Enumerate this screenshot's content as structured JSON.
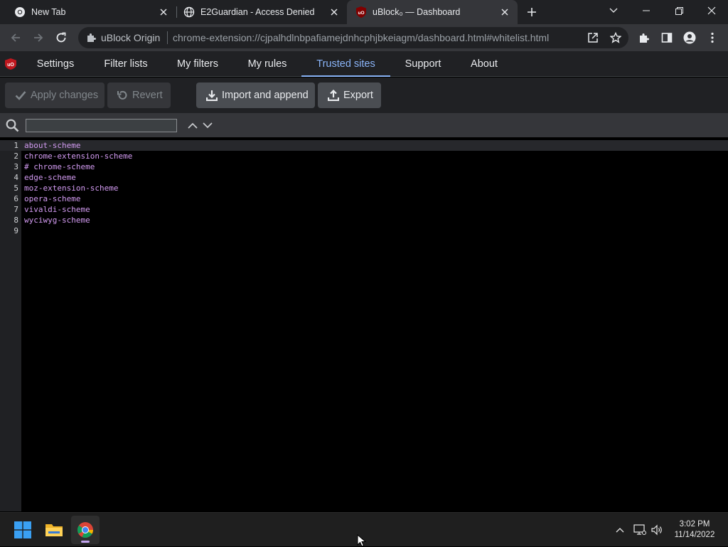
{
  "browser": {
    "tabs": [
      {
        "title": "New Tab",
        "favicon": "chrome-icon",
        "active": false
      },
      {
        "title": "E2Guardian - Access Denied",
        "favicon": "globe-icon",
        "active": false
      },
      {
        "title": "uBlock₀ — Dashboard",
        "favicon": "ublock-icon",
        "active": true
      }
    ],
    "omnibox": {
      "site_label": "uBlock Origin",
      "url": "chrome-extension://cjpalhdlnbpafiamejdnhcphjbkeiagm/dashboard.html#whitelist.html"
    }
  },
  "dashboard": {
    "nav": [
      {
        "label": "Settings",
        "active": false
      },
      {
        "label": "Filter lists",
        "active": false
      },
      {
        "label": "My filters",
        "active": false
      },
      {
        "label": "My rules",
        "active": false
      },
      {
        "label": "Trusted sites",
        "active": true
      },
      {
        "label": "Support",
        "active": false
      },
      {
        "label": "About",
        "active": false
      }
    ],
    "actions": {
      "apply_label": "Apply changes",
      "revert_label": "Revert",
      "import_label": "Import and append",
      "export_label": "Export"
    },
    "find": {
      "value": ""
    },
    "editor_lines": [
      {
        "n": "1",
        "text": "about-scheme"
      },
      {
        "n": "2",
        "text": "chrome-extension-scheme"
      },
      {
        "n": "3",
        "text": "# chrome-scheme"
      },
      {
        "n": "4",
        "text": "edge-scheme"
      },
      {
        "n": "5",
        "text": "moz-extension-scheme"
      },
      {
        "n": "6",
        "text": "opera-scheme"
      },
      {
        "n": "7",
        "text": "vivaldi-scheme"
      },
      {
        "n": "8",
        "text": "wyciwyg-scheme"
      },
      {
        "n": "9",
        "text": ""
      }
    ]
  },
  "taskbar": {
    "apps": [
      "windows-start-icon",
      "file-explorer-icon",
      "chrome-icon"
    ],
    "time": "3:02 PM",
    "date": "11/14/2022"
  },
  "colors": {
    "accent": "#8ab4f8",
    "editor_text": "#d39bf2",
    "ublock_red": "#c0181f"
  }
}
